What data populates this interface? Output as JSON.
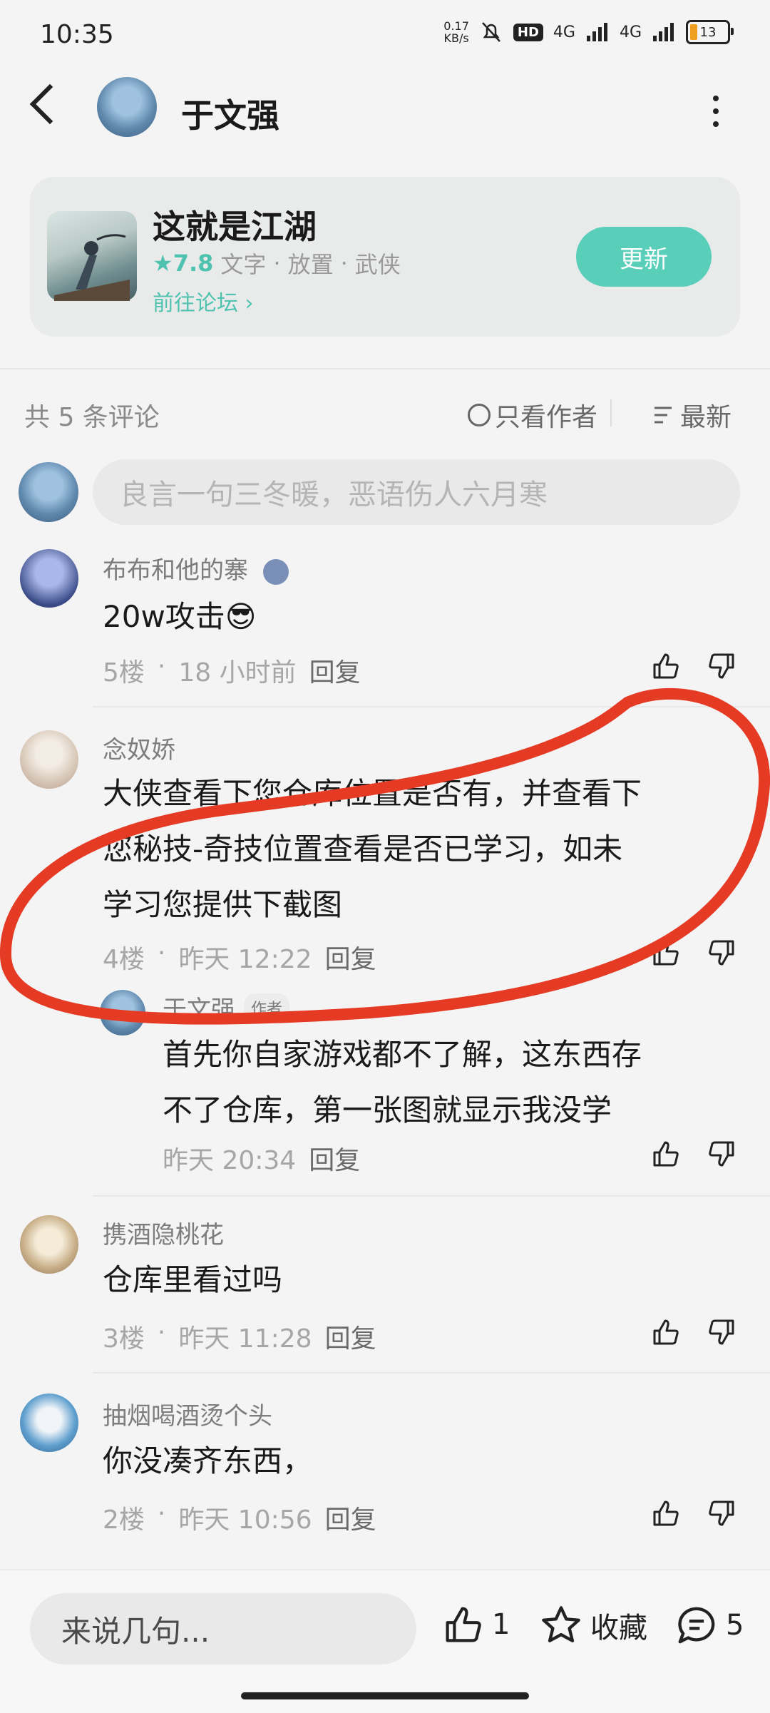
{
  "status_bar": {
    "time": "10:35",
    "net_speed_value": "0.17",
    "net_speed_unit": "KB/s",
    "hd_label": "HD",
    "net1": "4G",
    "net2": "4G",
    "battery": "13"
  },
  "header": {
    "name": "于文强"
  },
  "game": {
    "title": "这就是江湖",
    "rating": "7.8",
    "tags": [
      "文字",
      "放置",
      "武侠"
    ],
    "forum_link": "前往论坛 ›",
    "update_label": "更新"
  },
  "comments_bar": {
    "count_label": "共 5 条评论",
    "author_only_label": "只看作者",
    "sort_label": "最新"
  },
  "input": {
    "placeholder": "良言一句三冬暖，恶语伤人六月寒"
  },
  "comments": [
    {
      "user": "布布和他的寨",
      "text_lines": [
        "20w攻击😎"
      ],
      "floor": "5楼",
      "time": "18 小时前",
      "reply": "回复"
    },
    {
      "user": "念奴娇",
      "text_lines": [
        "大侠查看下您仓库位置是否有，并查看下",
        "您秘技-奇技位置查看是否已学习，如未",
        "学习您提供下截图"
      ],
      "floor": "4楼",
      "time": "昨天 12:22",
      "reply": "回复",
      "sub_reply": {
        "user": "于文强",
        "badge": "作者",
        "text_lines": [
          "首先你自家游戏都不了解，这东西存",
          "不了仓库，第一张图就显示我没学"
        ],
        "time": "昨天 20:34",
        "reply": "回复"
      }
    },
    {
      "user": "携酒隐桃花",
      "text_lines": [
        "仓库里看过吗"
      ],
      "floor": "3楼",
      "time": "昨天 11:28",
      "reply": "回复"
    },
    {
      "user": "抽烟喝酒烫个头",
      "text_lines": [
        "你没凑齐东西，"
      ],
      "floor": "2楼",
      "time": "昨天 10:56",
      "reply": "回复"
    }
  ],
  "bottom_bar": {
    "say_placeholder": "来说几句...",
    "like_count": "1",
    "collect_label": "收藏",
    "comment_count": "5"
  },
  "colors": {
    "accent": "#4fc3b0",
    "annotation_red": "#e53a24"
  }
}
